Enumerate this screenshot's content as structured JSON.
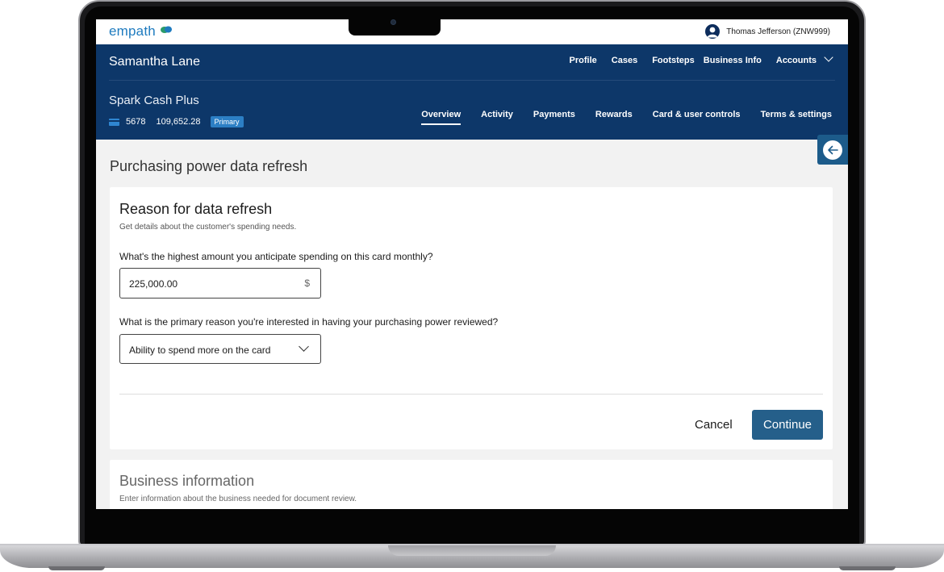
{
  "topbar": {
    "logo_text": "empath",
    "user_name": "Thomas Jefferson (ZNW999)"
  },
  "nav": {
    "customer_name": "Samantha Lane",
    "links": [
      "Profile",
      "Cases",
      "Footsteps",
      "Business Info",
      "Accounts"
    ],
    "card": {
      "name": "Spark Cash Plus",
      "last4": "5678",
      "balance": "109,652.28",
      "badge": "Primary"
    },
    "tabs": [
      "Overview",
      "Activity",
      "Payments",
      "Rewards",
      "Card & user controls",
      "Terms & settings"
    ],
    "active_tab": "Overview"
  },
  "page": {
    "title": "Purchasing power data refresh"
  },
  "refresh_form": {
    "title": "Reason for data refresh",
    "subtitle": "Get details about the customer's spending needs.",
    "q1_label": "What's the highest amount you anticipate spending on this card monthly?",
    "q1_value": "225,000.00",
    "q1_suffix": "$",
    "q2_label": "What is the primary reason you're interested in having your purchasing power reviewed?",
    "q2_value": "Ability to spend more on the card",
    "cancel_label": "Cancel",
    "continue_label": "Continue"
  },
  "business_form": {
    "title": "Business information",
    "subtitle": "Enter information about the business needed for document review."
  },
  "colors": {
    "nav_bg": "#0d3769",
    "brand": "#1e7bbf",
    "primary_button": "#255f8a",
    "badge": "#2c7fc5"
  },
  "icons": [
    "user-avatar-icon",
    "chevron-down-icon",
    "credit-card-icon",
    "arrow-left-icon"
  ]
}
